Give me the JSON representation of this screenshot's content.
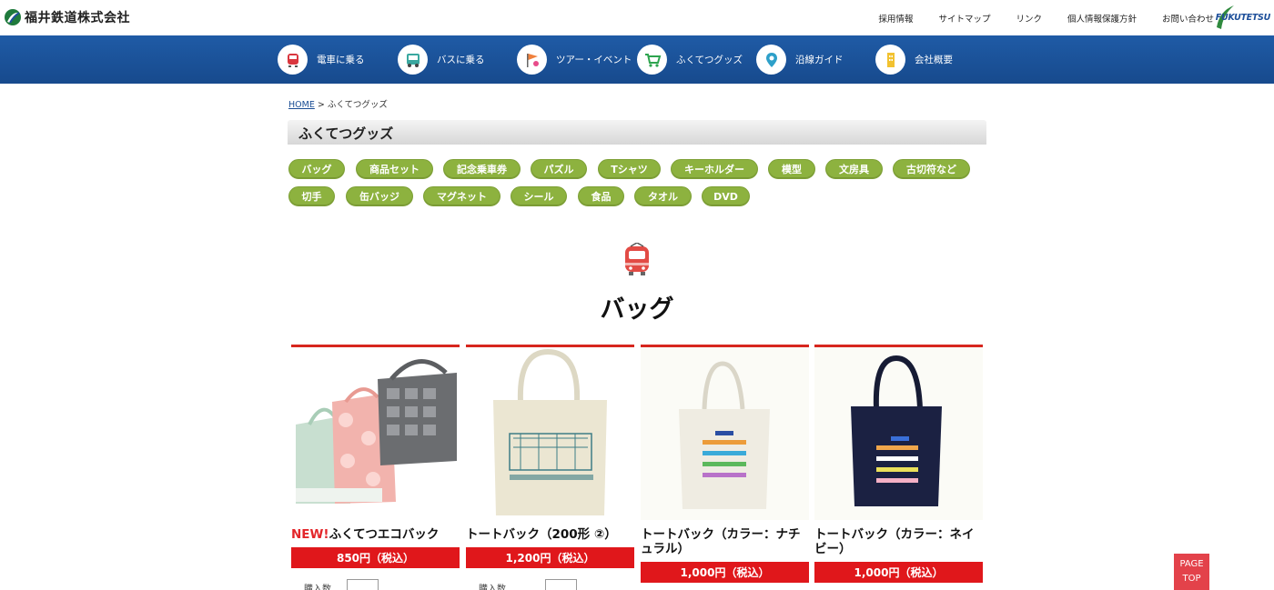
{
  "header": {
    "logo_text": "福井鉄道株式会社",
    "links": [
      "採用情報",
      "サイトマップ",
      "リンク",
      "個人情報保護方針",
      "お問い合わせ"
    ],
    "brand_text": "FUKUTETSU"
  },
  "nav": {
    "items": [
      {
        "label": "電車に乗る",
        "icon": "train-icon"
      },
      {
        "label": "バスに乗る",
        "icon": "bus-icon"
      },
      {
        "label": "ツアー・イベント",
        "icon": "flag-icon"
      },
      {
        "label": "ふくてつグッズ",
        "icon": "cart-icon"
      },
      {
        "label": "沿線ガイド",
        "icon": "map-pin-icon"
      },
      {
        "label": "会社概要",
        "icon": "building-icon"
      }
    ]
  },
  "breadcrumb": {
    "home": "HOME",
    "separator": ">",
    "current": "ふくてつグッズ"
  },
  "section_title": "ふくてつグッズ",
  "categories": [
    "バッグ",
    "商品セット",
    "記念乗車券",
    "パズル",
    "Tシャツ",
    "キーホルダー",
    "模型",
    "文房具",
    "古切符など",
    "切手",
    "缶バッジ",
    "マグネット",
    "シール",
    "食品",
    "タオル",
    "DVD"
  ],
  "category_heading": "バッグ",
  "products": [
    {
      "new_badge": "NEW!",
      "name": "ふくてつエコバック",
      "price": "850円（税込）",
      "qty_label": "購入数"
    },
    {
      "new_badge": "",
      "name": "トートバック（200形 ②）",
      "price": "1,200円（税込）",
      "qty_label": "購入数"
    },
    {
      "new_badge": "",
      "name": "トートバック（カラー：ナチュラル）",
      "price": "1,000円（税込）",
      "qty_label": ""
    },
    {
      "new_badge": "",
      "name": "トートバック（カラー：ネイビー）",
      "price": "1,000円（税込）",
      "qty_label": ""
    }
  ],
  "page_top": {
    "line1": "PAGE",
    "line2": "TOP"
  },
  "colors": {
    "nav_blue": "#1f5ba6",
    "category_green": "#8db23f",
    "price_red": "#e0171b",
    "accent_red": "#d7261e",
    "page_top": "#e3424a"
  }
}
